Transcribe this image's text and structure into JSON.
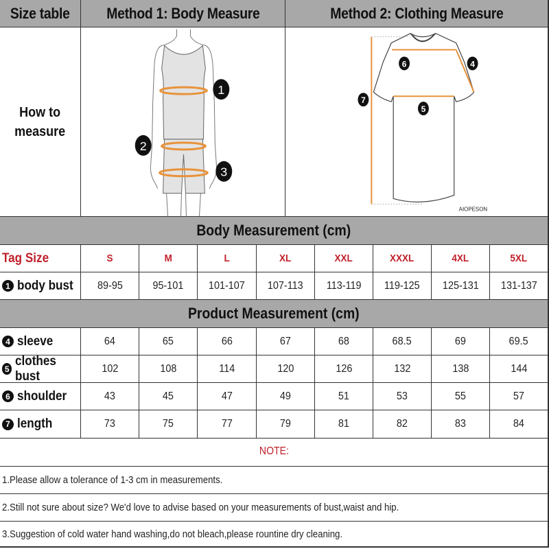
{
  "header": {
    "col1": "Size table",
    "col2": "Method 1: Body  Measure",
    "col3": "Method 2: Clothing Measure"
  },
  "how_to": {
    "line1": "How to",
    "line2": "measure",
    "body_markers": [
      "1",
      "2",
      "3"
    ],
    "clothing_markers": [
      "4",
      "5",
      "6",
      "7"
    ],
    "clothing_brand": "AIOPESON"
  },
  "body_section": {
    "title": "Body Measurement (cm)",
    "tag_label": "Tag Size",
    "sizes": [
      "S",
      "M",
      "L",
      "XL",
      "XXL",
      "XXXL",
      "4XL",
      "5XL"
    ],
    "rows": [
      {
        "num": "1",
        "label": "body bust",
        "values": [
          "89-95",
          "95-101",
          "101-107",
          "107-113",
          "113-119",
          "119-125",
          "125-131",
          "131-137"
        ]
      }
    ]
  },
  "product_section": {
    "title": "Product Measurement (cm)",
    "rows": [
      {
        "num": "4",
        "label": "sleeve",
        "values": [
          "64",
          "65",
          "66",
          "67",
          "68",
          "68.5",
          "69",
          "69.5"
        ]
      },
      {
        "num": "5",
        "label": "clothes bust",
        "values": [
          "102",
          "108",
          "114",
          "120",
          "126",
          "132",
          "138",
          "144"
        ]
      },
      {
        "num": "6",
        "label": "shoulder",
        "values": [
          "43",
          "45",
          "47",
          "49",
          "51",
          "53",
          "55",
          "57"
        ]
      },
      {
        "num": "7",
        "label": "length",
        "values": [
          "73",
          "75",
          "77",
          "79",
          "81",
          "82",
          "83",
          "84"
        ]
      }
    ]
  },
  "notes": {
    "title": "NOTE:",
    "items": [
      "1.Please allow a tolerance of 1-3 cm in measurements.",
      "2.Still not sure about size? We'd love to advise based on your measurements of bust,waist and hip.",
      "3.Suggestion of cold water hand washing,do not bleach,please rountine dry cleaning."
    ]
  },
  "colors": {
    "header_gray": "#a8a8a8",
    "accent_red": "#c0202a",
    "measure_orange": "#e8923a"
  }
}
